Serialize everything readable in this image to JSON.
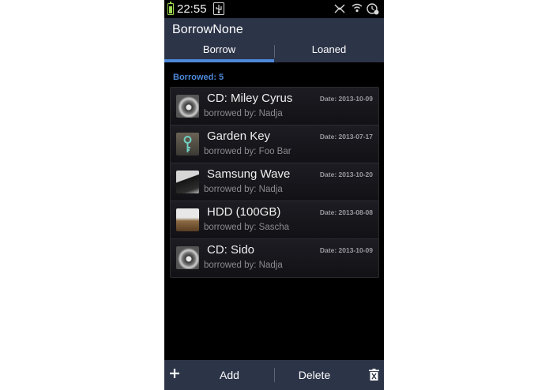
{
  "status_bar": {
    "time": "22:55",
    "icons": [
      "battery-icon",
      "usb-icon",
      "nfc-icon",
      "wifi-icon",
      "alarm-icon"
    ]
  },
  "app": {
    "title": "BorrowNone",
    "tabs": [
      {
        "label": "Borrow",
        "selected": true
      },
      {
        "label": "Loaned",
        "selected": false
      }
    ]
  },
  "list": {
    "count_label": "Borrowed: 5",
    "items": [
      {
        "title": "CD: Miley Cyrus",
        "subtitle": "borrowed by: Nadja",
        "date": "Date: 2013-10-09",
        "thumb": "cd-icon"
      },
      {
        "title": "Garden Key",
        "subtitle": "borrowed by: Foo Bar",
        "date": "Date: 2013-07-17",
        "thumb": "key-icon"
      },
      {
        "title": "Samsung Wave",
        "subtitle": "borrowed by: Nadja",
        "date": "Date: 2013-10-20",
        "thumb": "phone-icon"
      },
      {
        "title": "HDD (100GB)",
        "subtitle": "borrowed by: Sascha",
        "date": "Date: 2013-08-08",
        "thumb": "hdd-icon"
      },
      {
        "title": "CD: Sido",
        "subtitle": "borrowed by: Nadja",
        "date": "Date: 2013-10-09",
        "thumb": "cd-icon"
      }
    ]
  },
  "bottom_bar": {
    "add_label": "Add",
    "delete_label": "Delete"
  },
  "colors": {
    "accent": "#4d88d8",
    "bar_background": "#2c3448",
    "battery": "#9fd94f"
  }
}
